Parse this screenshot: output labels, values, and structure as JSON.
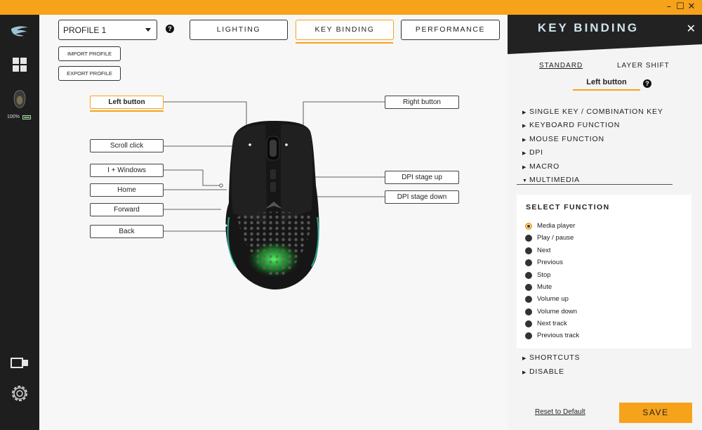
{
  "window": {
    "minimize_icon": "minimize-icon",
    "maximize_icon": "maximize-icon",
    "close_icon": "close-icon",
    "accent_color": "#f7a21b"
  },
  "sidebar": {
    "logo_icon": "glorious-logo-icon",
    "dashboard_icon": "grid-icon",
    "device_icon": "mouse-icon",
    "battery_percent": "100%",
    "bottom_icons": [
      "device-switch-icon",
      "gear-icon"
    ]
  },
  "toolbar": {
    "profile": "PROFILE 1",
    "help": "?",
    "import_profile": "IMPORT PROFILE",
    "export_profile": "EXPORT PROFILE",
    "tabs": [
      {
        "label": "LIGHTING",
        "active": false
      },
      {
        "label": "KEY BINDING",
        "active": true
      },
      {
        "label": "PERFORMANCE",
        "active": false
      }
    ]
  },
  "mouse_buttons": {
    "left_button": "Left button",
    "right_button": "Right button",
    "scroll_click": "Scroll click",
    "windows_key": "I + Windows",
    "home": "Home",
    "forward": "Forward",
    "back": "Back",
    "dpi_up": "DPI stage up",
    "dpi_down": "DPI stage down"
  },
  "panel": {
    "title": "KEY BINDING",
    "close": "✕",
    "modes": [
      "STANDARD",
      "LAYER SHIFT"
    ],
    "active_mode": "STANDARD",
    "selected_button": "Left button",
    "help": "?",
    "categories": [
      {
        "label": "SINGLE KEY / COMBINATION KEY",
        "expanded": false
      },
      {
        "label": "KEYBOARD FUNCTION",
        "expanded": false
      },
      {
        "label": "MOUSE FUNCTION",
        "expanded": false
      },
      {
        "label": "DPI",
        "expanded": false
      },
      {
        "label": "MACRO",
        "expanded": false
      },
      {
        "label": "MULTIMEDIA",
        "expanded": true
      }
    ],
    "select_function_title": "SELECT FUNCTION",
    "functions": [
      "Media player",
      "Play / pause",
      "Next",
      "Previous",
      "Stop",
      "Mute",
      "Volume up",
      "Volume down",
      "Next track",
      "Previous track"
    ],
    "selected_function": "Media player",
    "categories_after": [
      {
        "label": "SHORTCUTS",
        "expanded": false
      },
      {
        "label": "DISABLE",
        "expanded": false
      }
    ],
    "reset": "Reset to Default",
    "save": "SAVE"
  }
}
